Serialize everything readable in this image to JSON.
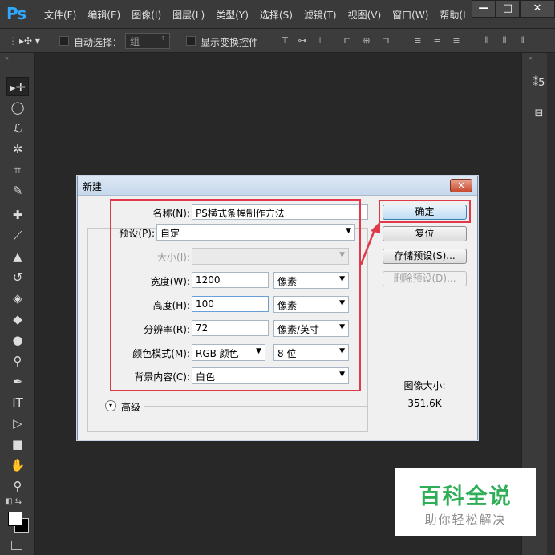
{
  "app": {
    "logo": "Ps"
  },
  "menu": [
    "文件(F)",
    "编辑(E)",
    "图像(I)",
    "图层(L)",
    "类型(Y)",
    "选择(S)",
    "滤镜(T)",
    "视图(V)",
    "窗口(W)",
    "帮助(I"
  ],
  "window_controls": {
    "minimize": "—",
    "maximize": "□",
    "close": "✕"
  },
  "options_bar": {
    "auto_select_label": "自动选择：",
    "auto_select_value": "组",
    "show_transform_label": "显示变换控件"
  },
  "dialog": {
    "title": "新建",
    "name_label": "名称(N):",
    "name_value": "PS横式条幅制作方法",
    "preset_label": "预设(P):",
    "preset_value": "自定",
    "size_label": "大小(I):",
    "width_label": "宽度(W):",
    "width_value": "1200",
    "width_unit": "像素",
    "height_label": "高度(H):",
    "height_value": "100",
    "height_unit": "像素",
    "resolution_label": "分辨率(R):",
    "resolution_value": "72",
    "resolution_unit": "像素/英寸",
    "color_mode_label": "颜色模式(M):",
    "color_mode_value": "RGB 颜色",
    "bit_depth_value": "8 位",
    "background_label": "背景内容(C):",
    "background_value": "白色",
    "advanced_label": "高级",
    "ok_button": "确定",
    "reset_button": "复位",
    "save_preset_button": "存储预设(S)...",
    "delete_preset_button": "删除预设(D)...",
    "image_size_label": "图像大小:",
    "image_size_value": "351.6K"
  },
  "watermark": {
    "title": "百科全说",
    "subtitle": "助你轻松解决"
  },
  "colors": {
    "highlight": "#e0394a",
    "watermark_green": "#2fae58",
    "ps_blue": "#31a8ff"
  }
}
